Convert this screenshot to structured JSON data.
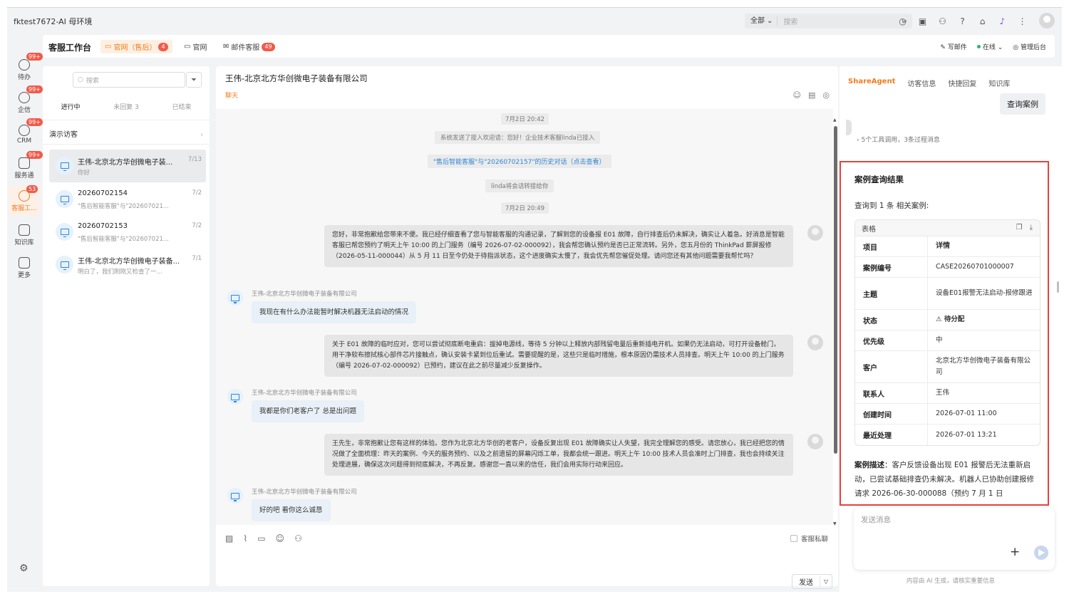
{
  "app": {
    "title": "fktest7672-AI 母环境",
    "scope_select": "全部",
    "search_placeholder": "搜索"
  },
  "nav": [
    {
      "label": "待办",
      "badge": "99+",
      "icon": "checklist-icon"
    },
    {
      "label": "企信",
      "badge": "99+",
      "icon": "chat-bubble-icon"
    },
    {
      "label": "CRM",
      "badge": "99+",
      "icon": "crm-icon"
    },
    {
      "label": "服务通",
      "badge": "99+",
      "icon": "service-icon"
    },
    {
      "label": "客服工...",
      "badge": "53",
      "icon": "headset-icon"
    },
    {
      "label": "知识库",
      "badge": "",
      "icon": "book-icon"
    },
    {
      "label": "更多",
      "badge": "",
      "icon": "grid-icon"
    }
  ],
  "workspace": {
    "title": "客服工作台",
    "tabs": [
      {
        "label": "官网（售后）",
        "badge": "4"
      },
      {
        "label": "官网",
        "badge": ""
      },
      {
        "label": "邮件客服",
        "badge": "49"
      }
    ],
    "write_mail": "写邮件",
    "status": "在线",
    "admin": "管理后台"
  },
  "sessions": {
    "search_placeholder": "搜索",
    "tabs": [
      "进行中",
      "未回复 3",
      "已结束"
    ],
    "group": "演示访客",
    "items": [
      {
        "name": "王伟-北京北方华创微电子装...",
        "preview": "你好",
        "date": "7/13"
      },
      {
        "name": "20260702154",
        "preview": "\"售后智能客服\"与\"202607021...",
        "date": "7/2"
      },
      {
        "name": "20260702153",
        "preview": "\"售后智能客服\"与\"202607021...",
        "date": "7/2"
      },
      {
        "name": "王伟-北京北方华创微电子装备...",
        "preview": "明白了，我们刚刚又检查了一...",
        "date": "7/1"
      }
    ]
  },
  "chat": {
    "title": "王伟-北京北方华创微电子装备有限公司",
    "sub": "聊天",
    "time1": "7月2日 20:42",
    "sys1": "系统发送了接入欢迎语：您好！企业技术客服linda已接入",
    "history_link": "\"售后智能客服\"与\"20260702157\"的历史对话（点击查看）",
    "sys2": "linda将会话转接给你",
    "time2": "7月2日 20:49",
    "agent1": "您好，非常抱歉给您带来不便。我已经仔细查看了您与智能客服的沟通记录，了解到您的设备报 E01 故障，自行排查后仍未解决，确实让人着急。好消息是智能客服已帮您预约了明天上午 10:00 的上门服务（编号 2026-07-02-000092），我会帮您确认预约是否已正常流转。另外，您五月份的 ThinkPad 薪屏报修（2026-05-11-000044）从 5 月 11 日至今仍处于待指派状态，这个进度确实太慢了，我会优先帮您催促处理。请问您还有其他问题需要我帮忙吗？",
    "customer_name": "王伟-北京北方华创微电子装备有限公司",
    "cust1": "我现在有什么办法能暂时解决机器无法启动的情况",
    "agent2": "关于 E01 故障的临时应对，您可以尝试彻底断电重启：拔掉电源线，等待 5 分钟以上释放内部残留电量后重新插电开机。如果仍无法启动，可打开设备舱门，用干净软布擦拭核心部件芯片接触点，确认安装卡紧到位后重试。需要提醒的是，这些只是临时措施，根本原因仍需技术人员排查。明天上午 10:00 的上门服务（编号 2026-07-02-000092）已预约，建议在此之前尽量减少反复操作。",
    "cust2": "我都是你们老客户了 总是出问题",
    "agent3": "王先生，非常抱歉让您有这样的体验。您作为北京北方华创的老客户，设备反复出现 E01 故障确实让人失望，我完全理解您的感受。请您放心，我已经把您的情况做了全面梳理：昨天的案例、今天的服务预约、以及之前遗留的屏幕闪烁工单，我都会统一跟进。明天上午 10:00 技术人员会准时上门排查，我也会持续关注处理进展，确保这次问题得到彻底解决，不再反复。感谢您一直以来的信任，我们会用实际行动来回应。",
    "cust3": "好的吧 看你这么诚恳",
    "private_label": "客服私聊",
    "send": "发送"
  },
  "right": {
    "tabs": [
      "ShareAgent",
      "访客信息",
      "快捷回复",
      "知识库"
    ],
    "query_button": "查询案例",
    "tools_summary": "5个工具调用，3条过程消息",
    "result_title": "案例查询结果",
    "result_count": "查询到 1 条 相关案例:",
    "table_label": "表格",
    "table": [
      {
        "k": "项目",
        "v": "详情"
      },
      {
        "k": "案例编号",
        "v": "CASE20260701000007"
      },
      {
        "k": "主题",
        "v": "设备E01报警无法启动-报修跟进"
      },
      {
        "k": "状态",
        "v": "⚠ 待分配"
      },
      {
        "k": "优先级",
        "v": "中"
      },
      {
        "k": "客户",
        "v": "北京北方华创微电子装备有限公司"
      },
      {
        "k": "联系人",
        "v": "王伟"
      },
      {
        "k": "创建时间",
        "v": "2026-07-01 11:00"
      },
      {
        "k": "最近处理",
        "v": "2026-07-01 13:21"
      }
    ],
    "desc_label": "案例描述",
    "desc_text": "：客户反馈设备出现 E01 报警后无法重新启动，已尝试基础排查仍未解决。机器人已协助创建报修请求 2026-06-30-000088（预约 7 月 1 日",
    "input_placeholder": "发送消息",
    "ai_note": "内容由 AI 生成，请核实重要信息"
  },
  "colors": {
    "accent": "#f07c1d",
    "badge": "#f25a4a",
    "link": "#2e86d6",
    "highlight_border": "#e5423c",
    "online": "#2fb36b"
  }
}
